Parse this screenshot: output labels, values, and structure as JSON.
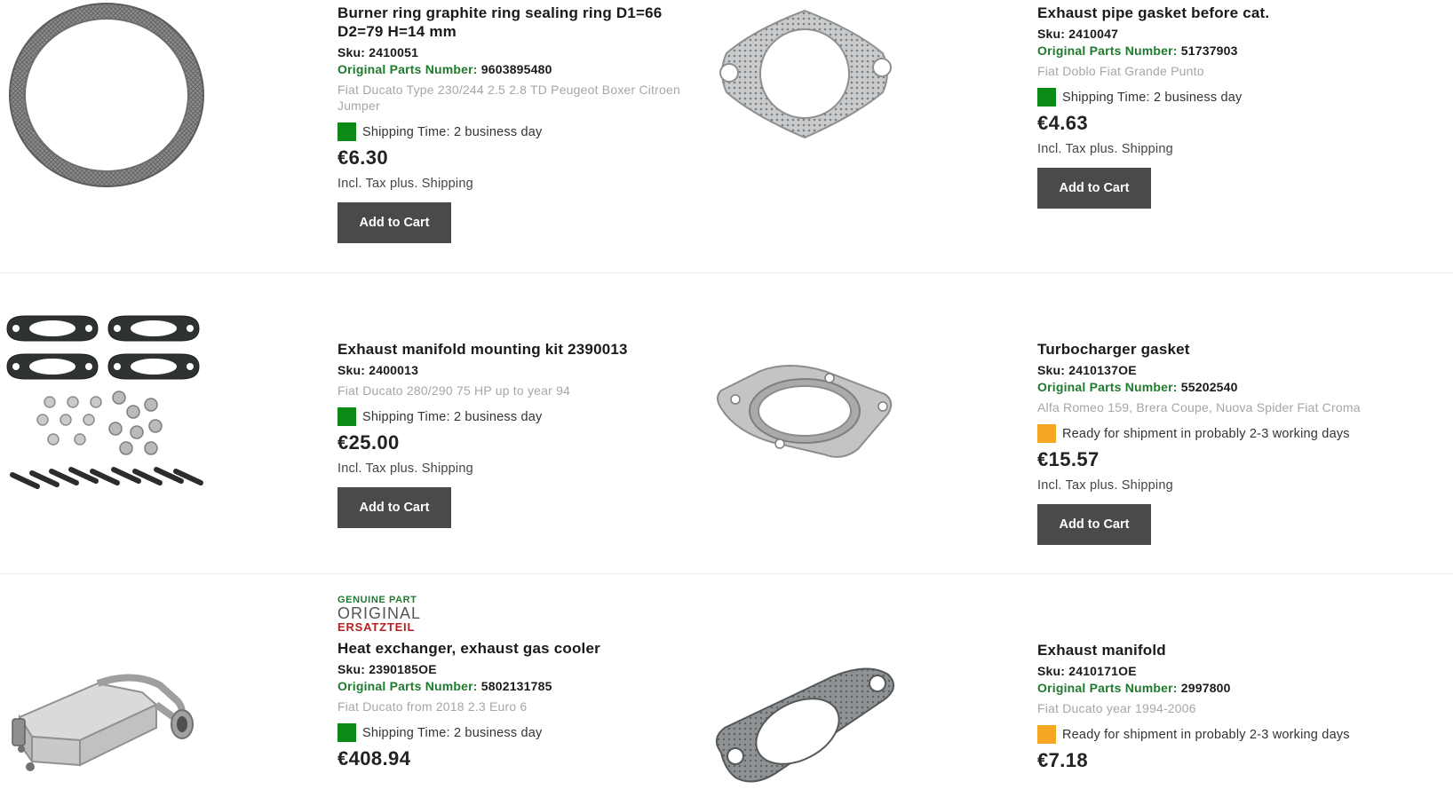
{
  "colors": {
    "green_status": "#0c8a16",
    "orange_status": "#f5a623",
    "button_bg": "#4a4a4a",
    "opn_label": "#1f7a2e"
  },
  "opn_label": "Original Parts Number:",
  "add_to_cart": "Add to Cart",
  "tax_note": "Incl. Tax plus. Shipping",
  "genuine_badge": {
    "line1": "GENUINE PART",
    "line2": "ORIGINAL",
    "line3": "ERSATZTEIL"
  },
  "products": [
    {
      "image": "graphite-ring-image",
      "title": "Burner ring graphite ring sealing ring D1=66 D2=79 H=14 mm",
      "sku": "Sku: 2410051",
      "opn": "9603895480",
      "fitment": "Fiat Ducato Type 230/244 2.5 2.8 TD Peugeot Boxer Citroen Jumper",
      "shipping": "Shipping Time: 2 business day",
      "status_color": "green",
      "price": "€6.30"
    },
    {
      "image": "exhaust-pipe-gasket-image",
      "title": "Exhaust pipe gasket before cat.",
      "sku": "Sku: 2410047",
      "opn": "51737903",
      "fitment": "Fiat Doblo Fiat Grande Punto",
      "shipping": "Shipping Time: 2 business day",
      "status_color": "green",
      "price": "€4.63"
    },
    {
      "image": "manifold-mounting-kit-image",
      "title": "Exhaust manifold mounting kit 2390013",
      "sku": "Sku: 2400013",
      "opn": "",
      "fitment": "Fiat Ducato 280/290 75 HP up to year 94",
      "shipping": "Shipping Time: 2 business day",
      "status_color": "green",
      "price": "€25.00"
    },
    {
      "image": "turbocharger-gasket-image",
      "title": "Turbocharger gasket",
      "sku": "Sku: 2410137OE",
      "opn": "55202540",
      "fitment": "Alfa Romeo 159, Brera Coupe, Nuova Spider Fiat Croma",
      "shipping": "Ready for shipment in probably 2-3 working days",
      "status_color": "orange",
      "price": "€15.57"
    },
    {
      "image": "exhaust-gas-cooler-image",
      "genuine": true,
      "title": "Heat exchanger, exhaust gas cooler",
      "sku": "Sku: 2390185OE",
      "opn": "5802131785",
      "fitment": "Fiat Ducato from 2018 2.3 Euro 6",
      "shipping": "Shipping Time: 2 business day",
      "status_color": "green",
      "price": "€408.94"
    },
    {
      "image": "exhaust-manifold-gasket-image",
      "title": "Exhaust manifold",
      "sku": "Sku: 2410171OE",
      "opn": "2997800",
      "fitment": "Fiat Ducato year 1994-2006",
      "shipping": "Ready for shipment in probably 2-3 working days",
      "status_color": "orange",
      "price": "€7.18"
    }
  ]
}
